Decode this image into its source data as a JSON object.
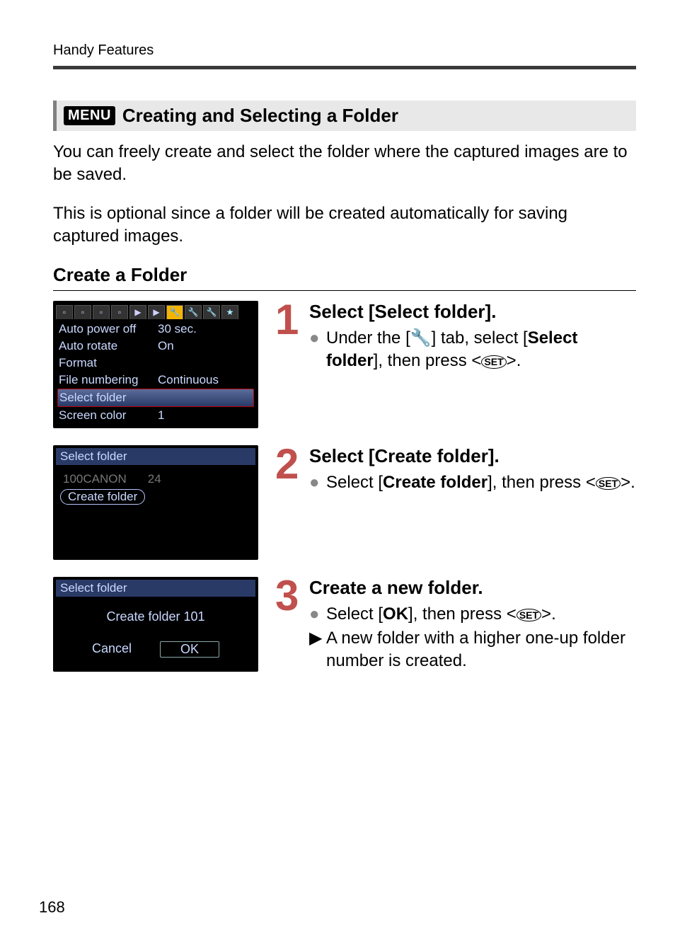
{
  "header": {
    "title": "Handy Features"
  },
  "section": {
    "menu_label": "MENU",
    "heading": "Creating and Selecting a Folder"
  },
  "intro": {
    "p1": "You can freely create and select the folder where the captured images are to be saved.",
    "p2": "This is optional since a folder will be created automatically for saving captured images."
  },
  "subhead": "Create a Folder",
  "shot1_menu": {
    "rows": [
      {
        "label": "Auto power off",
        "value": "30 sec."
      },
      {
        "label": "Auto rotate",
        "value": "On"
      },
      {
        "label": "Format",
        "value": ""
      },
      {
        "label": "File numbering",
        "value": "Continuous"
      },
      {
        "label": "Select folder",
        "value": "",
        "hl": true
      },
      {
        "label": "Screen color",
        "value": "1"
      }
    ]
  },
  "shot2": {
    "title": "Select folder",
    "folder_name": "100CANON",
    "folder_count": "24",
    "create_label": "Create folder"
  },
  "shot3": {
    "title": "Select folder",
    "dialog": "Create folder 101",
    "cancel": "Cancel",
    "ok": "OK"
  },
  "steps": {
    "s1": {
      "num": "1",
      "title": "Select [Select folder].",
      "b1_pre": "Under the [",
      "b1_mid": "] tab, select [",
      "b1_bold": "Select folder",
      "b1_post": "], then press <",
      "b1_end": ">."
    },
    "s2": {
      "num": "2",
      "title": "Select [Create folder].",
      "b1_pre": "Select [",
      "b1_bold": "Create folder",
      "b1_mid": "], then press <",
      "b1_end": ">."
    },
    "s3": {
      "num": "3",
      "title": "Create a new folder.",
      "b1_pre": "Select [",
      "b1_bold": "OK",
      "b1_mid": "], then press <",
      "b1_end": ">.",
      "b2": "A new folder with a higher one-up folder number is created."
    }
  },
  "icons": {
    "wrench": "🔧",
    "set": "SET",
    "rotate_cam": "📷",
    "rotate_mon": "🖥"
  },
  "page_number": "168"
}
